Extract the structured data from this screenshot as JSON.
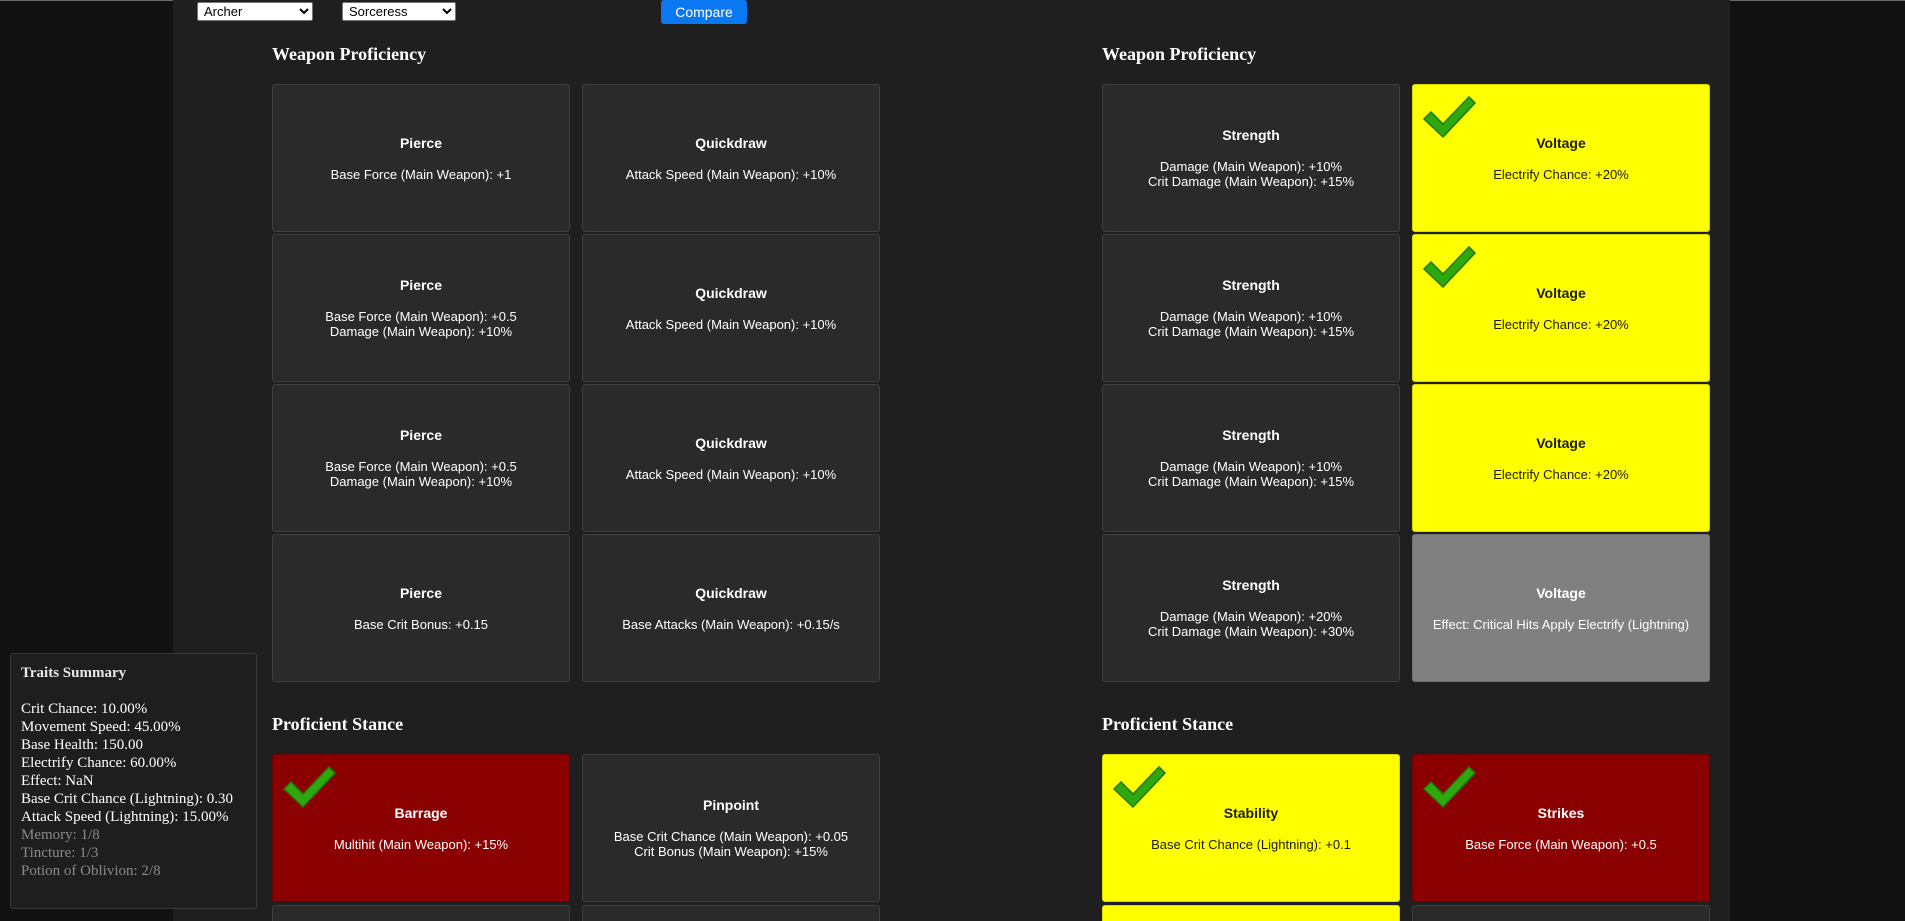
{
  "controls": {
    "left_select": "Archer",
    "right_select": "Sorceress",
    "compare_label": "Compare"
  },
  "left": {
    "weapon_title": "Weapon Proficiency",
    "weapon_cards": [
      {
        "name": "Pierce",
        "desc": "Base Force (Main Weapon): +1"
      },
      {
        "name": "Quickdraw",
        "desc": "Attack Speed (Main Weapon): +10%"
      },
      {
        "name": "Pierce",
        "desc": "Base Force (Main Weapon): +0.5\nDamage (Main Weapon): +10%"
      },
      {
        "name": "Quickdraw",
        "desc": "Attack Speed (Main Weapon): +10%"
      },
      {
        "name": "Pierce",
        "desc": "Base Force (Main Weapon): +0.5\nDamage (Main Weapon): +10%"
      },
      {
        "name": "Quickdraw",
        "desc": "Attack Speed (Main Weapon): +10%"
      },
      {
        "name": "Pierce",
        "desc": "Base Crit Bonus: +0.15"
      },
      {
        "name": "Quickdraw",
        "desc": "Base Attacks (Main Weapon): +0.15/s"
      }
    ],
    "stance_title": "Proficient Stance",
    "stance_cards": [
      {
        "name": "Barrage",
        "desc": "Multihit (Main Weapon): +15%",
        "state": "red",
        "checked": true
      },
      {
        "name": "Pinpoint",
        "desc": "Base Crit Chance (Main Weapon): +0.05\nCrit Bonus (Main Weapon): +15%",
        "state": "normal",
        "checked": false
      }
    ]
  },
  "right": {
    "weapon_title": "Weapon Proficiency",
    "weapon_cards": [
      {
        "name": "Strength",
        "desc": "Damage (Main Weapon): +10%\nCrit Damage (Main Weapon): +15%",
        "state": "normal",
        "checked": false
      },
      {
        "name": "Voltage",
        "desc": "Electrify Chance: +20%",
        "state": "yellow",
        "checked": true
      },
      {
        "name": "Strength",
        "desc": "Damage (Main Weapon): +10%\nCrit Damage (Main Weapon): +15%",
        "state": "normal",
        "checked": false
      },
      {
        "name": "Voltage",
        "desc": "Electrify Chance: +20%",
        "state": "yellow",
        "checked": true
      },
      {
        "name": "Strength",
        "desc": "Damage (Main Weapon): +10%\nCrit Damage (Main Weapon): +15%",
        "state": "normal",
        "checked": false
      },
      {
        "name": "Voltage",
        "desc": "Electrify Chance: +20%",
        "state": "yellow",
        "checked": false
      },
      {
        "name": "Strength",
        "desc": "Damage (Main Weapon): +20%\nCrit Damage (Main Weapon): +30%",
        "state": "normal",
        "checked": false
      },
      {
        "name": "Voltage",
        "desc": "Effect: Critical Hits Apply Electrify (Lightning)",
        "state": "gray",
        "checked": false
      }
    ],
    "stance_title": "Proficient Stance",
    "stance_cards": [
      {
        "name": "Stability",
        "desc": "Base Crit Chance (Lightning): +0.1",
        "state": "yellow",
        "checked": true
      },
      {
        "name": "Strikes",
        "desc": "Base Force (Main Weapon): +0.5",
        "state": "red",
        "checked": true
      }
    ]
  },
  "summary": {
    "title": "Traits Summary",
    "lines": [
      "Crit Chance: 10.00%",
      "Movement Speed: 45.00%",
      "Base Health: 150.00",
      "Electrify Chance: 60.00%",
      "Effect: NaN",
      "Base Crit Chance (Lightning): 0.30",
      "Attack Speed (Lightning): 15.00%"
    ],
    "dim_lines": [
      "Memory: 1/8",
      "Tincture: 1/3",
      "Potion of Oblivion: 2/8"
    ]
  },
  "colors": {
    "selected_yellow": "#ffff00",
    "selected_red": "#8b0000",
    "locked_gray": "#808080",
    "check_green": "#2fa80f",
    "compare_blue": "#0a78f0"
  }
}
